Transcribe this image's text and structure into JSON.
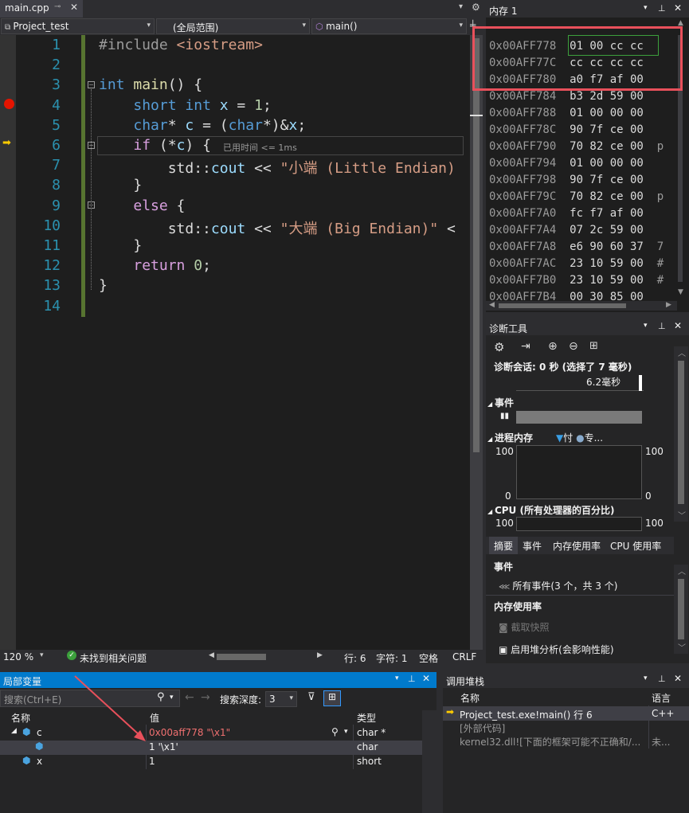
{
  "editor": {
    "tab_label": "main.cpp",
    "project_dropdown": "Project_test",
    "scope_dropdown": "(全局范围)",
    "function_dropdown": "main()",
    "lines": [
      {
        "n": "1",
        "html": "<span class='pp'>#include</span> <span class='str'>&lt;iostream&gt;</span>"
      },
      {
        "n": "2",
        "html": ""
      },
      {
        "n": "3",
        "html": "<span class='kw'>int</span> <span class='fn'>main</span>() {"
      },
      {
        "n": "4",
        "html": "    <span class='kw'>short</span> <span class='kw'>int</span> <span class='var'>x</span> = <span class='num'>1</span>;"
      },
      {
        "n": "5",
        "html": "    <span class='kw'>char</span>* <span class='var'>c</span> = (<span class='kw'>char</span>*)&amp;<span class='var'>x</span>;"
      },
      {
        "n": "6",
        "html": "    <span class='ctl'>if</span> (*<span class='var'>c</span>) {"
      },
      {
        "n": "7",
        "html": "        std::<span class='var'>cout</span> &lt;&lt; <span class='str'>\"小端 (Little Endian)</span>"
      },
      {
        "n": "8",
        "html": "    }"
      },
      {
        "n": "9",
        "html": "    <span class='ctl'>else</span> {"
      },
      {
        "n": "10",
        "html": "        std::<span class='var'>cout</span> &lt;&lt; <span class='str'>\"大端 (Big Endian)\"</span> &lt;"
      },
      {
        "n": "11",
        "html": "    }"
      },
      {
        "n": "12",
        "html": "    <span class='ctl'>return</span> <span class='num'>0</span>;"
      },
      {
        "n": "13",
        "html": "}"
      },
      {
        "n": "14",
        "html": ""
      }
    ],
    "elapsed_hint": "已用时间 <= 1ms",
    "status": {
      "zoom": "120 %",
      "issues": "未找到相关问题",
      "line": "行: 6",
      "char": "字符: 1",
      "space": "空格",
      "eol": "CRLF"
    }
  },
  "memory": {
    "title": "内存 1",
    "rows": [
      {
        "addr": "0x00AFF778",
        "bytes": "01 00 cc cc"
      },
      {
        "addr": "0x00AFF77C",
        "bytes": "cc cc cc cc"
      },
      {
        "addr": "0x00AFF780",
        "bytes": "a0 f7 af 00"
      },
      {
        "addr": "0x00AFF784",
        "bytes": "b3 2d 59 00"
      },
      {
        "addr": "0x00AFF788",
        "bytes": "01 00 00 00"
      },
      {
        "addr": "0x00AFF78C",
        "bytes": "90 7f ce 00"
      },
      {
        "addr": "0x00AFF790",
        "bytes": "70 82 ce 00"
      },
      {
        "addr": "0x00AFF794",
        "bytes": "01 00 00 00"
      },
      {
        "addr": "0x00AFF798",
        "bytes": "90 7f ce 00"
      },
      {
        "addr": "0x00AFF79C",
        "bytes": "70 82 ce 00"
      },
      {
        "addr": "0x00AFF7A0",
        "bytes": "fc f7 af 00"
      },
      {
        "addr": "0x00AFF7A4",
        "bytes": "07 2c 59 00"
      },
      {
        "addr": "0x00AFF7A8",
        "bytes": "e6 90 60 37"
      },
      {
        "addr": "0x00AFF7AC",
        "bytes": "23 10 59 00"
      },
      {
        "addr": "0x00AFF7B0",
        "bytes": "23 10 59 00"
      },
      {
        "addr": "0x00AFF7B4",
        "bytes": "00 30 85 00"
      }
    ],
    "tail_chars": [
      "",
      "",
      "",
      "",
      "",
      "",
      "p",
      "",
      "",
      "p",
      "",
      "",
      "7",
      "#",
      "#",
      ""
    ]
  },
  "diag": {
    "title": "诊断工具",
    "session": "诊断会话: 0 秒 (选择了 7 毫秒)",
    "timeline_label": "6.2毫秒",
    "events_label": "事件",
    "memory_label": "进程内存",
    "legend_a": "忖",
    "legend_b": "专...",
    "mem_max": "100",
    "mem_min": "0",
    "mem_max_r": "100",
    "mem_min_r": "0",
    "cpu_label": "CPU (所有处理器的百分比)",
    "cpu_max": "100",
    "cpu_max_r": "100",
    "tabs": [
      "摘要",
      "事件",
      "内存使用率",
      "CPU 使用率"
    ],
    "sec_events": "事件",
    "all_events": "所有事件(3 个，共 3 个)",
    "sec_memory": "内存使用率",
    "snapshot": "截取快照",
    "heap": "启用堆分析(会影响性能)"
  },
  "locals": {
    "title": "局部变量",
    "search_placeholder": "搜索(Ctrl+E)",
    "depth_label": "搜索深度:",
    "depth_value": "3",
    "headers": [
      "名称",
      "值",
      "类型"
    ],
    "rows": [
      {
        "name": "c",
        "value": "0x00aff778 \"\\x1\"",
        "type": "char *"
      },
      {
        "name": "",
        "value": "1 '\\x1'",
        "type": "char"
      },
      {
        "name": "x",
        "value": "1",
        "type": "short"
      }
    ]
  },
  "callstack": {
    "title": "调用堆栈",
    "headers": [
      "名称",
      "语言"
    ],
    "rows": [
      {
        "name": "Project_test.exe!main() 行 6",
        "lang": "C++"
      },
      {
        "name": "[外部代码]",
        "lang": ""
      },
      {
        "name": "kernel32.dll![下面的框架可能不正确和/...",
        "lang": "未..."
      }
    ]
  },
  "colors": {
    "accent": "#007acc",
    "highlight": "#e8505b",
    "breakpoint": "#e51400",
    "current_line_arrow": "#ffcc00"
  }
}
